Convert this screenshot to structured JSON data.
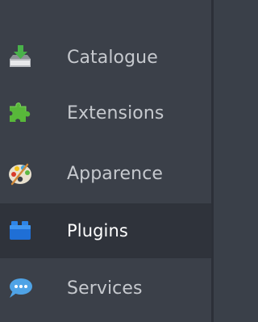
{
  "menu": {
    "items": [
      {
        "label": "Catalogue",
        "icon": "catalog-tray-icon",
        "active": false
      },
      {
        "label": "Extensions",
        "icon": "puzzle-piece-icon",
        "active": false
      },
      {
        "label": "Apparence",
        "icon": "paint-palette-icon",
        "active": false
      },
      {
        "label": "Plugins",
        "icon": "blue-blocks-icon",
        "active": true
      },
      {
        "label": "Services",
        "icon": "speech-bubble-icon",
        "active": false
      }
    ]
  },
  "colors": {
    "background": "#3b4049",
    "active_background": "#2f333b",
    "text": "#c6c9ce",
    "active_text": "#ffffff"
  }
}
